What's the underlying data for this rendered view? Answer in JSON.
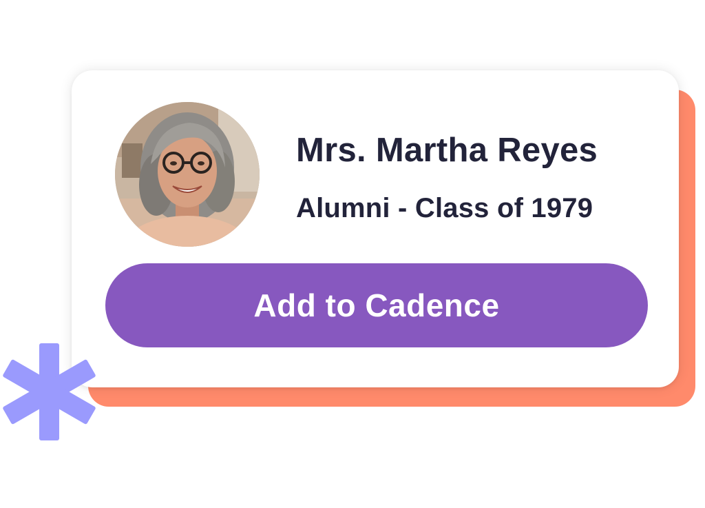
{
  "colors": {
    "accent_back": "#FF8A6B",
    "button_bg": "#8758BF",
    "text_primary": "#22233A",
    "button_text": "#FFFFFF",
    "asterisk": "#9A9AFD"
  },
  "profile": {
    "name": "Mrs. Martha Reyes",
    "subtitle": "Alumni - Class of 1979",
    "avatar_icon": "person-photo"
  },
  "action": {
    "label": "Add to Cadence"
  },
  "decoration": {
    "icon": "asterisk-icon"
  }
}
